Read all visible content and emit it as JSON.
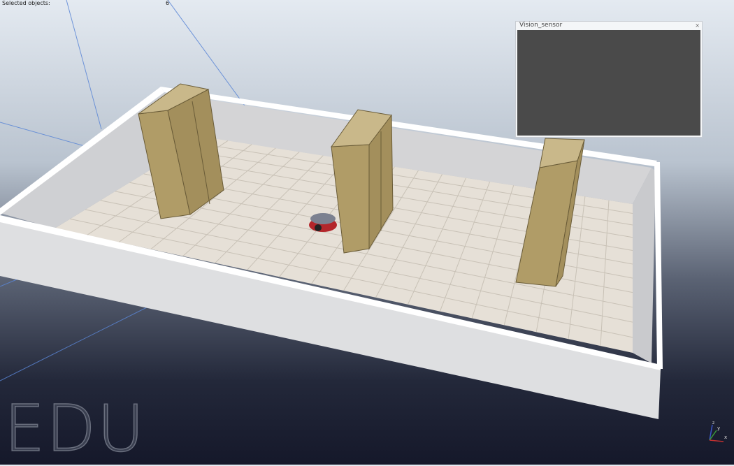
{
  "viewport": {
    "selected_objects_label": "Selected objects:",
    "selected_count": "6",
    "watermark": "EDU",
    "axis_labels": {
      "x": "x",
      "y": "y",
      "z": "z"
    }
  },
  "vision_sensor_window": {
    "title": "Vision_sensor",
    "close_label": "×"
  },
  "colors": {
    "floor": "#e6e0d7",
    "wall": "#d9d9da",
    "box": "#b29e6a",
    "sensor_bg": "#4a4a4a"
  }
}
